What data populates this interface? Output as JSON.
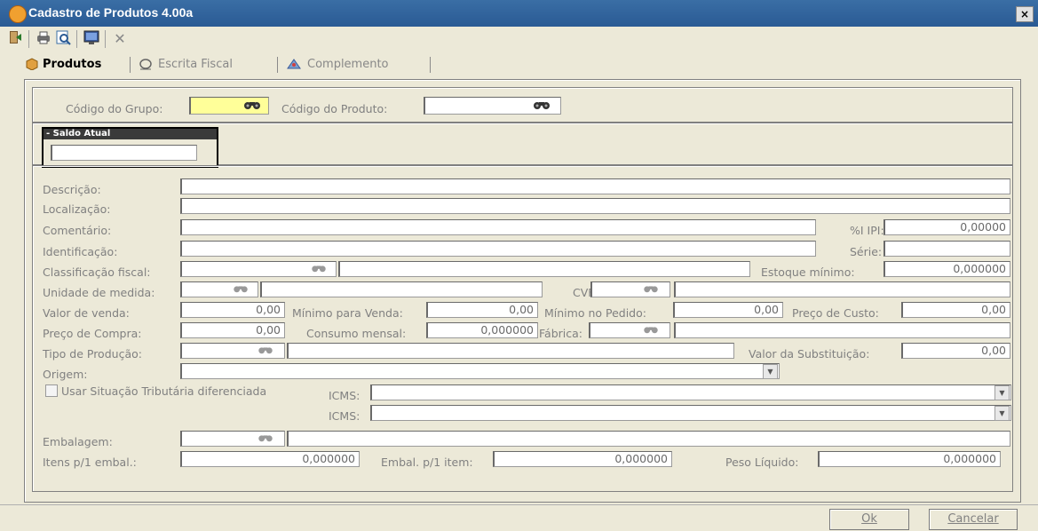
{
  "window": {
    "title": "Cadastro de Produtos 4.00a",
    "close_glyph": "×"
  },
  "toolbar": {
    "icons": [
      "exit-icon",
      "print-icon",
      "preview-icon",
      "monitor-icon",
      "close-x-icon"
    ],
    "close_glyph": "✕"
  },
  "tabs": [
    {
      "label": "Produtos",
      "icon": "box-icon",
      "active": true
    },
    {
      "label": "Escrita Fiscal",
      "icon": "fiscal-icon",
      "active": false
    },
    {
      "label": "Complemento",
      "icon": "complement-icon",
      "active": false
    }
  ],
  "top": {
    "grupo_label": "Código do Grupo:",
    "grupo_value": "",
    "produto_label": "Código do Produto:",
    "produto_value": "",
    "search_glyph": "🔭"
  },
  "saldo": {
    "title": "- Saldo Atual",
    "value": ""
  },
  "form": {
    "descricao": "Descrição:",
    "localizacao": "Localização:",
    "comentario": "Comentário:",
    "ipi_label": "%I IPI:",
    "ipi_value": "0,00000",
    "identificacao": "Identificação:",
    "serie_label": "Série:",
    "classificacao": "Classificação fiscal:",
    "estoque_label": "Estoque mínimo:",
    "estoque_value": "0,000000",
    "unidade": "Unidade de medida:",
    "cvf_label": "CVF:",
    "valor_venda_label": "Valor de venda:",
    "valor_venda": "0,00",
    "minimo_venda_label": "Mínimo para Venda:",
    "minimo_venda": "0,00",
    "minimo_pedido_label": "Mínimo no Pedido:",
    "minimo_pedido": "0,00",
    "preco_custo_label": "Preço de Custo:",
    "preco_custo": "0,00",
    "preco_compra_label": "Preço de Compra:",
    "preco_compra": "0,00",
    "consumo_label": "Consumo mensal:",
    "consumo": "0,000000",
    "fabrica_label": "Fábrica:",
    "tipo_producao": "Tipo de Produção:",
    "valor_subst_label": "Valor da Substituição:",
    "valor_subst": "0,00",
    "origem": "Origem:",
    "usar_situacao": "Usar Situação Tributária diferenciada",
    "icms1": "ICMS:",
    "icms2": "ICMS:",
    "embalagem": "Embalagem:",
    "itens_label": "Itens p/1 embal.:",
    "itens": "0,000000",
    "embal_item_label": "Embal. p/1 item:",
    "embal_item": "0,000000",
    "peso_label": "Peso Líquido:",
    "peso": "0,000000",
    "dropdown_glyph": "▼"
  },
  "buttons": {
    "ok": "Ok",
    "cancelar": "Cancelar"
  }
}
